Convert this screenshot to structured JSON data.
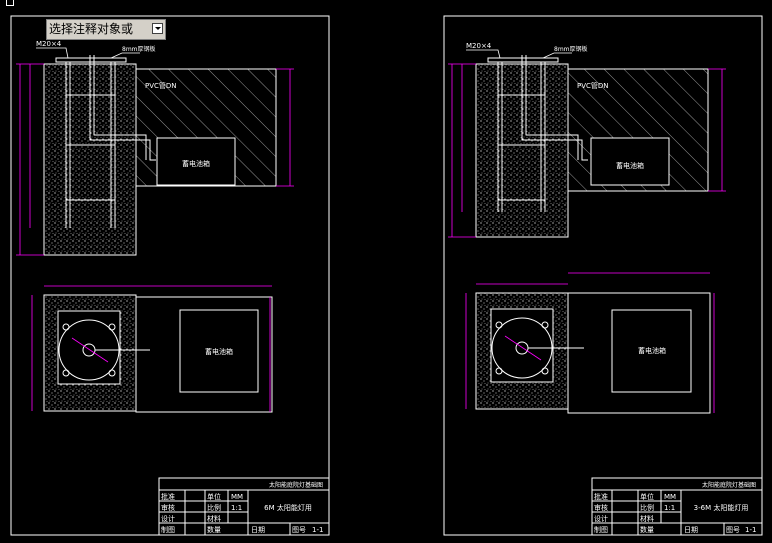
{
  "prompt": {
    "text": "选择注释对象或"
  },
  "drawings": [
    {
      "id": "left",
      "bolt_label": "M20×4",
      "plate_label": "8mm厚钢板",
      "pipe_label": "PVC管DN",
      "battery_label": "蓄电池箱",
      "battery_label_plan": "蓄电池箱",
      "title_block": {
        "header": "太阳能庭院灯基础图",
        "rows": [
          [
            "批准",
            "单位",
            "MM"
          ],
          [
            "审核",
            "比例",
            "1:1"
          ],
          [
            "设计",
            "材料",
            ""
          ],
          [
            "制图",
            "数量",
            "日期"
          ]
        ],
        "drawing_name": "6M 太阳能灯用",
        "sheet": "1-1",
        "sheet_label": "图号"
      }
    },
    {
      "id": "right",
      "bolt_label": "M20×4",
      "plate_label": "8mm厚钢板",
      "pipe_label": "PVC管DN",
      "battery_label": "蓄电池箱",
      "battery_label_plan": "蓄电池箱",
      "title_block": {
        "header": "太阳能庭院灯基础图",
        "rows": [
          [
            "批准",
            "单位",
            "MM"
          ],
          [
            "审核",
            "比例",
            "1:1"
          ],
          [
            "设计",
            "材料",
            ""
          ],
          [
            "制图",
            "数量",
            "日期"
          ]
        ],
        "drawing_name": "3-6M 太阳能灯用",
        "sheet": "1-1",
        "sheet_label": "图号"
      }
    }
  ],
  "colors": {
    "background": "#000000",
    "lines": "#ffffff",
    "dimensions": "#ff00ff",
    "concrete": "#ffffff",
    "prompt_bg": "#d4d0c8"
  }
}
